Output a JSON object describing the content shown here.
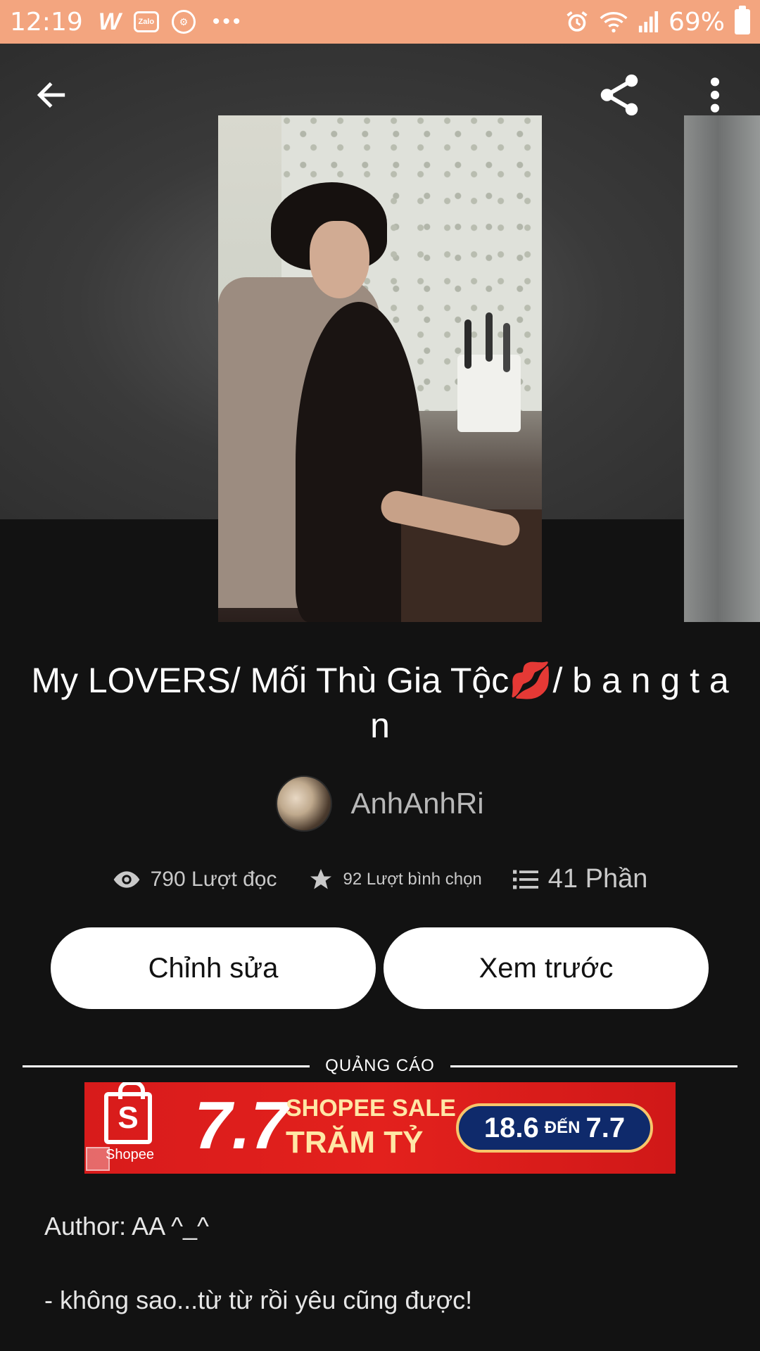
{
  "status_bar": {
    "time": "12:19",
    "battery": "69%",
    "apps": [
      "W",
      "Zalo"
    ]
  },
  "header": {
    "back_icon": "arrow-left-icon",
    "share_icon": "share-icon",
    "more_icon": "more-vertical-icon"
  },
  "story": {
    "title": "My LOVERS/ Mối Thù Gia Tộc💋/ b a n g t a n",
    "author": "AnhAnhRi",
    "stats": {
      "reads": "790 Lượt đọc",
      "votes": "92 Lượt bình chọn",
      "parts": "41 Phần"
    }
  },
  "actions": {
    "edit_label": "Chỉnh sửa",
    "preview_label": "Xem trước"
  },
  "ad": {
    "label": "QUẢNG CÁO",
    "brand": "Shopee",
    "bag_letter": "S",
    "headline_number": "7.7",
    "headline_top": "SHOPEE SALE",
    "headline_bottom": "TRĂM TỶ",
    "date_from": "18.6",
    "date_word": "ĐẾN",
    "date_to": "7.7"
  },
  "description": {
    "line1": "Author: AA ^_^",
    "line2": "- không sao...từ từ rồi yêu cũng được!"
  },
  "colors": {
    "status_bar": "#f3a57f",
    "background": "#121212",
    "ad_red": "#d81b1b"
  }
}
